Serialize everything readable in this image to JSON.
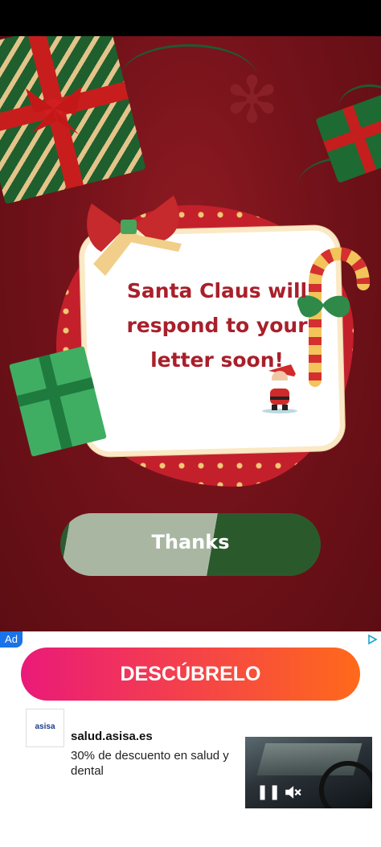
{
  "card": {
    "message": "Santa Claus will respond to your letter soon!"
  },
  "buttons": {
    "thanks_label": "Thanks"
  },
  "ad": {
    "badge": "Ad",
    "cta_label": "DESCÚBRELO",
    "advertiser_logo_text": "asisa",
    "domain": "salud.asisa.es",
    "description": "30% de descuento en salud y dental",
    "video_controls": {
      "pause_icon": "pause-icon",
      "mute_icon": "mute-icon"
    }
  },
  "colors": {
    "background": "#74121a",
    "card_text": "#a8202b",
    "button_dark": "#2a5a2c",
    "button_light": "#a9b7a2",
    "cta_start": "#ea1a79",
    "cta_end": "#ff6a1a",
    "ad_badge": "#1a73e8"
  }
}
